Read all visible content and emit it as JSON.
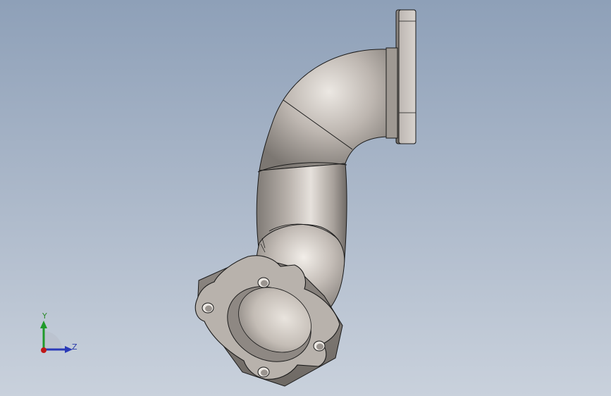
{
  "viewport": {
    "background_top": "#8ea0b8",
    "background_bottom": "#c9d1dc"
  },
  "model": {
    "part": "exhaust-elbow-pipe",
    "body_color": "#a59e98",
    "edge_color": "#1a1a1a"
  },
  "triad": {
    "y_label": "Y",
    "z_label": "Z",
    "y_color": "#1f9a2a",
    "z_color": "#2a3ab8",
    "x_color": "#c01818"
  }
}
